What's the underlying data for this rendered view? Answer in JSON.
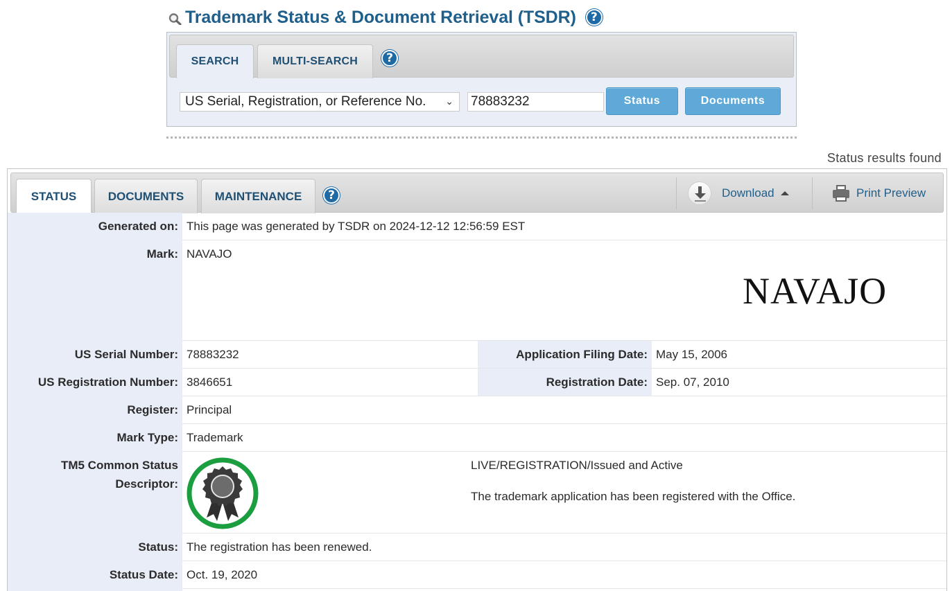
{
  "header": {
    "title": "Trademark Status & Document Retrieval (TSDR)",
    "help_glyph": "?"
  },
  "search": {
    "tabs": [
      {
        "label": "SEARCH",
        "active": true
      },
      {
        "label": "MULTI-SEARCH",
        "active": false
      }
    ],
    "help_glyph": "?",
    "select_value": "US Serial, Registration, or Reference No.",
    "input_value": "78883232",
    "status_button": "Status",
    "documents_button": "Documents"
  },
  "results": {
    "found_text": "Status results found",
    "tabs": [
      {
        "label": "STATUS",
        "active": true
      },
      {
        "label": "DOCUMENTS",
        "active": false
      },
      {
        "label": "MAINTENANCE",
        "active": false
      }
    ],
    "help_glyph": "?",
    "download_label": "Download",
    "print_label": "Print Preview"
  },
  "record": {
    "generated_on": {
      "label": "Generated on:",
      "value": "This page was generated by TSDR on 2024-12-12 12:56:59 EST"
    },
    "mark": {
      "label": "Mark:",
      "value": "NAVAJO",
      "image_text": "NAVAJO"
    },
    "serial_number": {
      "label": "US Serial Number:",
      "value": "78883232"
    },
    "filing_date": {
      "label": "Application Filing Date:",
      "value": "May 15, 2006"
    },
    "registration_number": {
      "label": "US Registration Number:",
      "value": "3846651"
    },
    "registration_date": {
      "label": "Registration Date:",
      "value": "Sep. 07, 2010"
    },
    "register": {
      "label": "Register:",
      "value": "Principal"
    },
    "mark_type": {
      "label": "Mark Type:",
      "value": "Trademark"
    },
    "tm5": {
      "label_line1": "TM5 Common Status",
      "label_line2": "Descriptor:",
      "status": "LIVE/REGISTRATION/Issued and Active",
      "description": "The trademark application has been registered with the Office."
    },
    "status": {
      "label": "Status:",
      "value": "The registration has been renewed."
    },
    "status_date": {
      "label": "Status Date:",
      "value": "Oct. 19, 2020"
    }
  },
  "colors": {
    "title_blue": "#1f5f8b",
    "button_blue": "#5fa9d8",
    "label_bg": "#e9edf8",
    "seal_green": "#1a9e3f"
  }
}
